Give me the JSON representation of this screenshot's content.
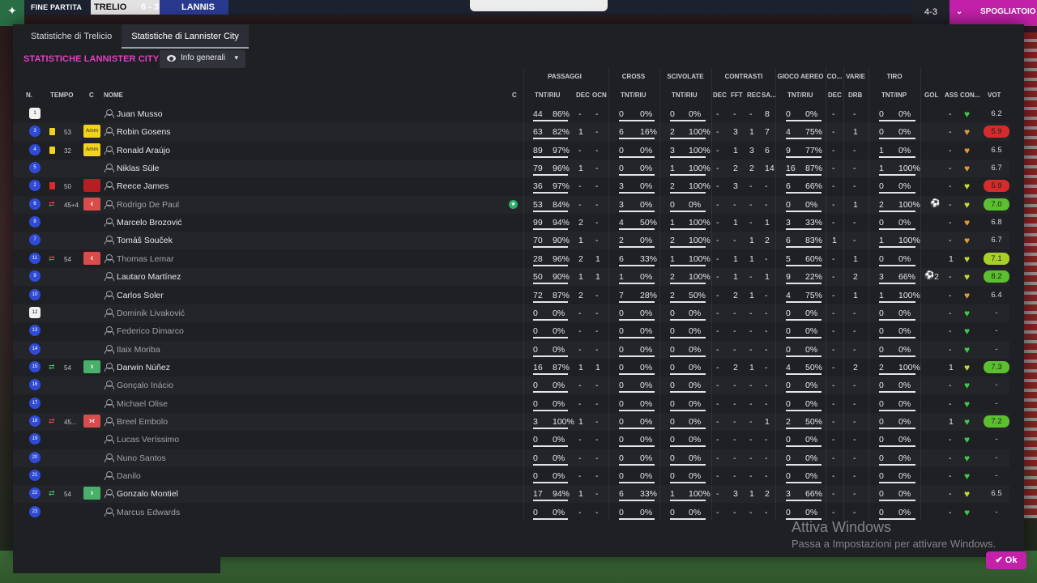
{
  "topbar": {
    "status": "FINE PARTITA",
    "home_team": "TRELIO",
    "score": "6 - 3",
    "away_team": "LANNIS",
    "right_value": "4-3",
    "right_action": "SPOGLIATOIO"
  },
  "tabs": [
    {
      "label": "Statistiche di Trelicio",
      "active": false
    },
    {
      "label": "Statistiche di Lannister City",
      "active": true
    }
  ],
  "section_title": "STATISTICHE LANNISTER CITY",
  "view_select": "Info generali",
  "groups": {
    "passaggi": "PASSAGGI",
    "cross": "CROSS",
    "scivolate": "SCIVOLATE",
    "contrasti": "CONTRASTI",
    "gioco_aereo": "GIOCO AEREO",
    "co": "CO...",
    "varie": "VARIE",
    "tiro": "TIRO"
  },
  "headers": {
    "n": "N.",
    "tempo": "TEMPO",
    "c": "C",
    "nome": "NOME",
    "c2": "C",
    "pass_tnt": "TNT/RIU",
    "pass_dec": "DEC",
    "pass_ocn": "OCN",
    "cross_tnt": "TNT/RIU",
    "sciv_tnt": "TNT/RIU",
    "con_dec": "DEC",
    "con_fft": "FFT",
    "con_rec": "REC",
    "con_sa": "SA...",
    "aereo_tnt": "TNT/RIU",
    "co_dec": "DEC",
    "varie_drb": "DRB",
    "tiro_tnt": "TNT/INP",
    "gol": "GOL",
    "ass": "ASS",
    "con": "CON...",
    "vot": "VOT"
  },
  "players": [
    {
      "num": "1",
      "gk": true,
      "card": "",
      "tempo": "",
      "cbox": "",
      "name": "Juan Musso",
      "dim": false,
      "star": false,
      "p": [
        "44",
        "86%"
      ],
      "pdec": "-",
      "pocn": "-",
      "cr": [
        "0",
        "0%"
      ],
      "sv": [
        "0",
        "0%"
      ],
      "con": [
        "-",
        "-",
        "-",
        "8"
      ],
      "ae": [
        "0",
        "0%"
      ],
      "codec": "-",
      "drb": "-",
      "ti": [
        "0",
        "0%"
      ],
      "gol": "",
      "ass": "-",
      "heart": "#3ec94a",
      "vot": "6.2",
      "vcls": ""
    },
    {
      "num": "3",
      "gk": false,
      "card": "y",
      "tempo": "53",
      "cbox": "Amm",
      "name": "Robin Gosens",
      "dim": false,
      "star": false,
      "p": [
        "63",
        "82%"
      ],
      "pdec": "1",
      "pocn": "-",
      "cr": [
        "6",
        "16%"
      ],
      "sv": [
        "2",
        "100%"
      ],
      "con": [
        "-",
        "3",
        "1",
        "7"
      ],
      "ae": [
        "4",
        "75%"
      ],
      "codec": "-",
      "drb": "1",
      "ti": [
        "0",
        "0%"
      ],
      "gol": "",
      "ass": "-",
      "heart": "#e29a3b",
      "vot": "5.9",
      "vcls": "red"
    },
    {
      "num": "4",
      "gk": false,
      "card": "y",
      "tempo": "32",
      "cbox": "Amm",
      "name": "Ronald Araújo",
      "dim": false,
      "star": false,
      "p": [
        "89",
        "97%"
      ],
      "pdec": "-",
      "pocn": "-",
      "cr": [
        "0",
        "0%"
      ],
      "sv": [
        "3",
        "100%"
      ],
      "con": [
        "-",
        "1",
        "3",
        "6"
      ],
      "ae": [
        "9",
        "77%"
      ],
      "codec": "-",
      "drb": "-",
      "ti": [
        "1",
        "0%"
      ],
      "gol": "",
      "ass": "-",
      "heart": "#e29a3b",
      "vot": "6.5",
      "vcls": ""
    },
    {
      "num": "5",
      "gk": false,
      "card": "",
      "tempo": "",
      "cbox": "",
      "name": "Niklas Süle",
      "dim": false,
      "star": false,
      "p": [
        "79",
        "96%"
      ],
      "pdec": "1",
      "pocn": "-",
      "cr": [
        "0",
        "0%"
      ],
      "sv": [
        "1",
        "100%"
      ],
      "con": [
        "-",
        "2",
        "2",
        "14"
      ],
      "ae": [
        "16",
        "87%"
      ],
      "codec": "-",
      "drb": "-",
      "ti": [
        "1",
        "100%"
      ],
      "gol": "",
      "ass": "-",
      "heart": "#e29a3b",
      "vot": "6.7",
      "vcls": ""
    },
    {
      "num": "2",
      "gk": false,
      "card": "r",
      "tempo": "50",
      "cbox": "red",
      "name": "Reece James",
      "dim": false,
      "star": false,
      "p": [
        "36",
        "97%"
      ],
      "pdec": "-",
      "pocn": "-",
      "cr": [
        "3",
        "0%"
      ],
      "sv": [
        "2",
        "100%"
      ],
      "con": [
        "-",
        "3",
        "-",
        "-"
      ],
      "ae": [
        "6",
        "66%"
      ],
      "codec": "-",
      "drb": "-",
      "ti": [
        "0",
        "0%"
      ],
      "gol": "",
      "ass": "-",
      "heart": "#c8d83a",
      "vot": "5.9",
      "vcls": "red"
    },
    {
      "num": "6",
      "gk": false,
      "card": "out",
      "tempo": "45+4",
      "cbox": "out",
      "name": "Rodrigo De Paul",
      "dim": true,
      "star": true,
      "p": [
        "53",
        "84%"
      ],
      "pdec": "-",
      "pocn": "-",
      "cr": [
        "3",
        "0%"
      ],
      "sv": [
        "0",
        "0%"
      ],
      "con": [
        "-",
        "-",
        "-",
        "-"
      ],
      "ae": [
        "0",
        "0%"
      ],
      "codec": "-",
      "drb": "1",
      "ti": [
        "2",
        "100%"
      ],
      "gol": "ball",
      "ass": "-",
      "heart": "#c8d83a",
      "vot": "7.0",
      "vcls": "green"
    },
    {
      "num": "8",
      "gk": false,
      "card": "",
      "tempo": "",
      "cbox": "",
      "name": "Marcelo Brozović",
      "dim": false,
      "star": false,
      "p": [
        "99",
        "94%"
      ],
      "pdec": "2",
      "pocn": "-",
      "cr": [
        "4",
        "50%"
      ],
      "sv": [
        "1",
        "100%"
      ],
      "con": [
        "-",
        "1",
        "-",
        "1"
      ],
      "ae": [
        "3",
        "33%"
      ],
      "codec": "-",
      "drb": "-",
      "ti": [
        "0",
        "0%"
      ],
      "gol": "",
      "ass": "-",
      "heart": "#e29a3b",
      "vot": "6.8",
      "vcls": ""
    },
    {
      "num": "7",
      "gk": false,
      "card": "",
      "tempo": "",
      "cbox": "",
      "name": "Tomáš Souček",
      "dim": false,
      "star": false,
      "p": [
        "70",
        "90%"
      ],
      "pdec": "1",
      "pocn": "-",
      "cr": [
        "2",
        "0%"
      ],
      "sv": [
        "2",
        "100%"
      ],
      "con": [
        "-",
        "-",
        "1",
        "2"
      ],
      "ae": [
        "6",
        "83%"
      ],
      "codec": "1",
      "drb": "-",
      "ti": [
        "1",
        "100%"
      ],
      "gol": "",
      "ass": "-",
      "heart": "#e29a3b",
      "vot": "6.7",
      "vcls": ""
    },
    {
      "num": "11",
      "gk": false,
      "card": "out",
      "tempo": "54",
      "cbox": "out",
      "name": "Thomas Lemar",
      "dim": true,
      "star": false,
      "p": [
        "28",
        "96%"
      ],
      "pdec": "2",
      "pocn": "1",
      "cr": [
        "6",
        "33%"
      ],
      "sv": [
        "1",
        "100%"
      ],
      "con": [
        "-",
        "1",
        "1",
        "-"
      ],
      "ae": [
        "5",
        "60%"
      ],
      "codec": "-",
      "drb": "1",
      "ti": [
        "0",
        "0%"
      ],
      "gol": "",
      "ass": "1",
      "heart": "#c8d83a",
      "vot": "7.1",
      "vcls": "lime"
    },
    {
      "num": "9",
      "gk": false,
      "card": "",
      "tempo": "",
      "cbox": "",
      "name": "Lautaro Martínez",
      "dim": false,
      "star": false,
      "p": [
        "50",
        "90%"
      ],
      "pdec": "1",
      "pocn": "1",
      "cr": [
        "1",
        "0%"
      ],
      "sv": [
        "2",
        "100%"
      ],
      "con": [
        "-",
        "1",
        "-",
        "1"
      ],
      "ae": [
        "9",
        "22%"
      ],
      "codec": "-",
      "drb": "2",
      "ti": [
        "3",
        "66%"
      ],
      "gol": "ball2",
      "ass": "-",
      "heart": "#c8d83a",
      "vot": "8.2",
      "vcls": "green"
    },
    {
      "num": "10",
      "gk": false,
      "card": "",
      "tempo": "",
      "cbox": "",
      "name": "Carlos Soler",
      "dim": false,
      "star": false,
      "p": [
        "72",
        "87%"
      ],
      "pdec": "2",
      "pocn": "-",
      "cr": [
        "7",
        "28%"
      ],
      "sv": [
        "2",
        "50%"
      ],
      "con": [
        "-",
        "2",
        "1",
        "-"
      ],
      "ae": [
        "4",
        "75%"
      ],
      "codec": "-",
      "drb": "1",
      "ti": [
        "1",
        "100%"
      ],
      "gol": "",
      "ass": "-",
      "heart": "#e29a3b",
      "vot": "6.4",
      "vcls": ""
    },
    {
      "num": "12",
      "gk": true,
      "card": "",
      "tempo": "",
      "cbox": "",
      "name": "Dominik Livaković",
      "dim": true,
      "star": false,
      "p": [
        "0",
        "0%"
      ],
      "pdec": "-",
      "pocn": "-",
      "cr": [
        "0",
        "0%"
      ],
      "sv": [
        "0",
        "0%"
      ],
      "con": [
        "-",
        "-",
        "-",
        "-"
      ],
      "ae": [
        "0",
        "0%"
      ],
      "codec": "-",
      "drb": "-",
      "ti": [
        "0",
        "0%"
      ],
      "gol": "",
      "ass": "-",
      "heart": "#3ec94a",
      "vot": "-",
      "vcls": ""
    },
    {
      "num": "13",
      "gk": false,
      "card": "",
      "tempo": "",
      "cbox": "",
      "name": "Federico Dimarco",
      "dim": true,
      "star": false,
      "p": [
        "0",
        "0%"
      ],
      "pdec": "-",
      "pocn": "-",
      "cr": [
        "0",
        "0%"
      ],
      "sv": [
        "0",
        "0%"
      ],
      "con": [
        "-",
        "-",
        "-",
        "-"
      ],
      "ae": [
        "0",
        "0%"
      ],
      "codec": "-",
      "drb": "-",
      "ti": [
        "0",
        "0%"
      ],
      "gol": "",
      "ass": "-",
      "heart": "#3ec94a",
      "vot": "-",
      "vcls": ""
    },
    {
      "num": "14",
      "gk": false,
      "card": "",
      "tempo": "",
      "cbox": "",
      "name": "Ilaix Moriba",
      "dim": true,
      "star": false,
      "p": [
        "0",
        "0%"
      ],
      "pdec": "-",
      "pocn": "-",
      "cr": [
        "0",
        "0%"
      ],
      "sv": [
        "0",
        "0%"
      ],
      "con": [
        "-",
        "-",
        "-",
        "-"
      ],
      "ae": [
        "0",
        "0%"
      ],
      "codec": "-",
      "drb": "-",
      "ti": [
        "0",
        "0%"
      ],
      "gol": "",
      "ass": "-",
      "heart": "#3ec94a",
      "vot": "-",
      "vcls": ""
    },
    {
      "num": "15",
      "gk": false,
      "card": "in",
      "tempo": "54",
      "cbox": "in",
      "name": "Darwin Núñez",
      "dim": false,
      "star": false,
      "p": [
        "16",
        "87%"
      ],
      "pdec": "1",
      "pocn": "1",
      "cr": [
        "0",
        "0%"
      ],
      "sv": [
        "0",
        "0%"
      ],
      "con": [
        "-",
        "2",
        "1",
        "-"
      ],
      "ae": [
        "4",
        "50%"
      ],
      "codec": "-",
      "drb": "2",
      "ti": [
        "2",
        "100%"
      ],
      "gol": "",
      "ass": "1",
      "heart": "#c8d83a",
      "vot": "7.3",
      "vcls": "green"
    },
    {
      "num": "16",
      "gk": false,
      "card": "",
      "tempo": "",
      "cbox": "",
      "name": "Gonçalo Inácio",
      "dim": true,
      "star": false,
      "p": [
        "0",
        "0%"
      ],
      "pdec": "-",
      "pocn": "-",
      "cr": [
        "0",
        "0%"
      ],
      "sv": [
        "0",
        "0%"
      ],
      "con": [
        "-",
        "-",
        "-",
        "-"
      ],
      "ae": [
        "0",
        "0%"
      ],
      "codec": "-",
      "drb": "-",
      "ti": [
        "0",
        "0%"
      ],
      "gol": "",
      "ass": "-",
      "heart": "#3ec94a",
      "vot": "-",
      "vcls": ""
    },
    {
      "num": "17",
      "gk": false,
      "card": "",
      "tempo": "",
      "cbox": "",
      "name": "Michael Olise",
      "dim": true,
      "star": false,
      "p": [
        "0",
        "0%"
      ],
      "pdec": "-",
      "pocn": "-",
      "cr": [
        "0",
        "0%"
      ],
      "sv": [
        "0",
        "0%"
      ],
      "con": [
        "-",
        "-",
        "-",
        "-"
      ],
      "ae": [
        "0",
        "0%"
      ],
      "codec": "-",
      "drb": "-",
      "ti": [
        "0",
        "0%"
      ],
      "gol": "",
      "ass": "-",
      "heart": "#3ec94a",
      "vot": "-",
      "vcls": ""
    },
    {
      "num": "18",
      "gk": false,
      "card": "both",
      "tempo": "45...",
      "cbox": "both",
      "name": "Breel Embolo",
      "dim": true,
      "star": false,
      "p": [
        "3",
        "100%"
      ],
      "pdec": "1",
      "pocn": "-",
      "cr": [
        "0",
        "0%"
      ],
      "sv": [
        "0",
        "0%"
      ],
      "con": [
        "-",
        "-",
        "-",
        "1"
      ],
      "ae": [
        "2",
        "50%"
      ],
      "codec": "-",
      "drb": "-",
      "ti": [
        "0",
        "0%"
      ],
      "gol": "",
      "ass": "1",
      "heart": "#3ec94a",
      "vot": "7.2",
      "vcls": "green"
    },
    {
      "num": "19",
      "gk": false,
      "card": "",
      "tempo": "",
      "cbox": "",
      "name": "Lucas Veríssimo",
      "dim": true,
      "star": false,
      "p": [
        "0",
        "0%"
      ],
      "pdec": "-",
      "pocn": "-",
      "cr": [
        "0",
        "0%"
      ],
      "sv": [
        "0",
        "0%"
      ],
      "con": [
        "-",
        "-",
        "-",
        "-"
      ],
      "ae": [
        "0",
        "0%"
      ],
      "codec": "-",
      "drb": "-",
      "ti": [
        "0",
        "0%"
      ],
      "gol": "",
      "ass": "-",
      "heart": "#3ec94a",
      "vot": "-",
      "vcls": ""
    },
    {
      "num": "20",
      "gk": false,
      "card": "",
      "tempo": "",
      "cbox": "",
      "name": "Nuno Santos",
      "dim": true,
      "star": false,
      "p": [
        "0",
        "0%"
      ],
      "pdec": "-",
      "pocn": "-",
      "cr": [
        "0",
        "0%"
      ],
      "sv": [
        "0",
        "0%"
      ],
      "con": [
        "-",
        "-",
        "-",
        "-"
      ],
      "ae": [
        "0",
        "0%"
      ],
      "codec": "-",
      "drb": "-",
      "ti": [
        "0",
        "0%"
      ],
      "gol": "",
      "ass": "-",
      "heart": "#3ec94a",
      "vot": "-",
      "vcls": ""
    },
    {
      "num": "21",
      "gk": false,
      "card": "",
      "tempo": "",
      "cbox": "",
      "name": "Danilo",
      "dim": true,
      "star": false,
      "p": [
        "0",
        "0%"
      ],
      "pdec": "-",
      "pocn": "-",
      "cr": [
        "0",
        "0%"
      ],
      "sv": [
        "0",
        "0%"
      ],
      "con": [
        "-",
        "-",
        "-",
        "-"
      ],
      "ae": [
        "0",
        "0%"
      ],
      "codec": "-",
      "drb": "-",
      "ti": [
        "0",
        "0%"
      ],
      "gol": "",
      "ass": "-",
      "heart": "#3ec94a",
      "vot": "-",
      "vcls": ""
    },
    {
      "num": "22",
      "gk": false,
      "card": "in",
      "tempo": "54",
      "cbox": "in",
      "name": "Gonzalo Montiel",
      "dim": false,
      "star": false,
      "p": [
        "17",
        "94%"
      ],
      "pdec": "1",
      "pocn": "-",
      "cr": [
        "6",
        "33%"
      ],
      "sv": [
        "1",
        "100%"
      ],
      "con": [
        "-",
        "3",
        "1",
        "2"
      ],
      "ae": [
        "3",
        "66%"
      ],
      "codec": "-",
      "drb": "-",
      "ti": [
        "0",
        "0%"
      ],
      "gol": "",
      "ass": "-",
      "heart": "#c8d83a",
      "vot": "6.5",
      "vcls": ""
    },
    {
      "num": "23",
      "gk": false,
      "card": "",
      "tempo": "",
      "cbox": "",
      "name": "Marcus Edwards",
      "dim": true,
      "star": false,
      "p": [
        "0",
        "0%"
      ],
      "pdec": "-",
      "pocn": "-",
      "cr": [
        "0",
        "0%"
      ],
      "sv": [
        "0",
        "0%"
      ],
      "con": [
        "-",
        "-",
        "-",
        "-"
      ],
      "ae": [
        "0",
        "0%"
      ],
      "codec": "-",
      "drb": "-",
      "ti": [
        "0",
        "0%"
      ],
      "gol": "",
      "ass": "-",
      "heart": "#3ec94a",
      "vot": "-",
      "vcls": ""
    }
  ],
  "gol_extra": "2",
  "watermark": {
    "title": "Attiva Windows",
    "subtitle": "Passa a Impostazioni per attivare Windows."
  },
  "ok_label": "Ok",
  "colors": {
    "accent": "#c321a9",
    "title_pink": "#e63fc7",
    "panel_bg": "#1e2024",
    "rating_red": "#d42c2c",
    "rating_green": "#5bbf2f"
  }
}
